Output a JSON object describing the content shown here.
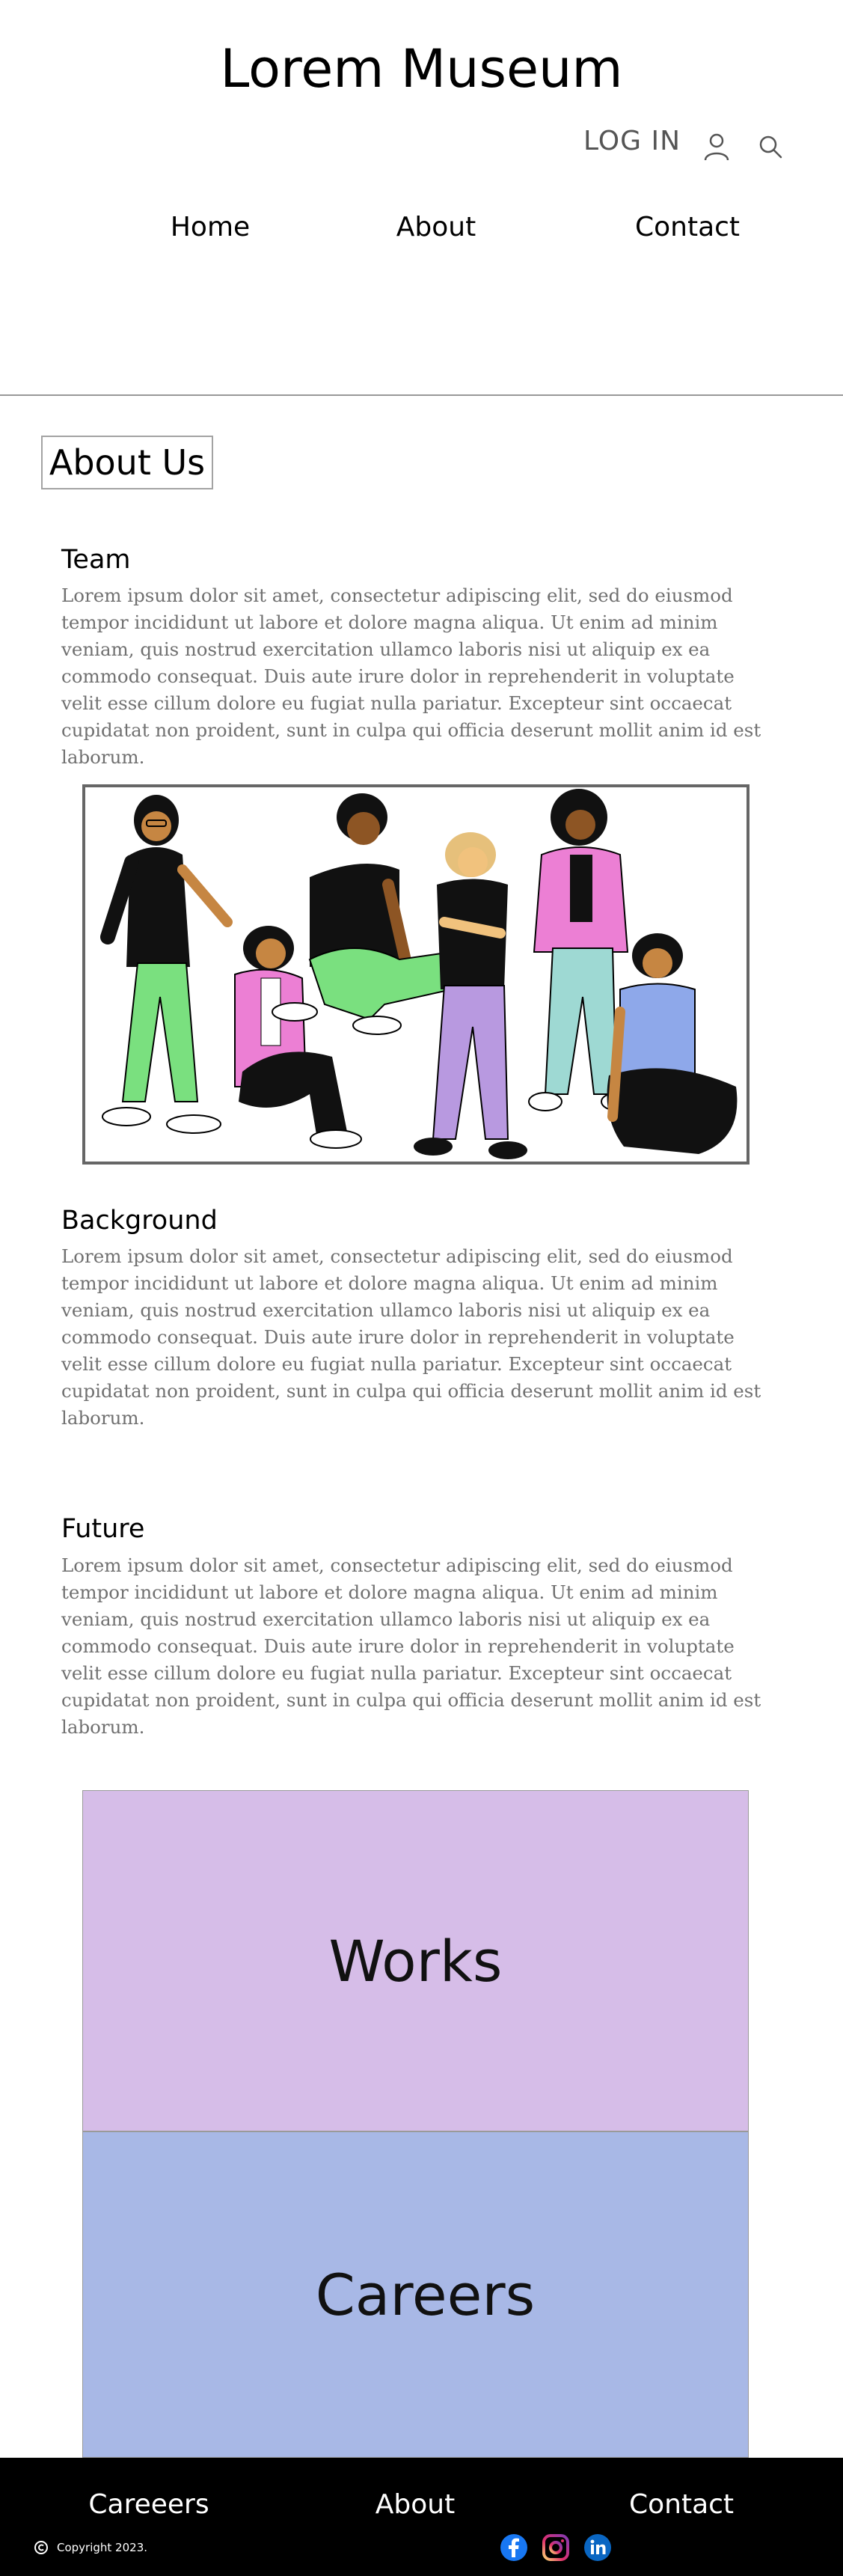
{
  "header": {
    "site_title": "Lorem Museum",
    "login_label": "LOG IN",
    "user_icon": "user-icon",
    "search_icon": "search-icon"
  },
  "nav": {
    "items": [
      {
        "label": "Home"
      },
      {
        "label": "About"
      },
      {
        "label": "Contact"
      }
    ]
  },
  "about": {
    "heading": "About Us",
    "sections": [
      {
        "title": "Team",
        "text": "Lorem ipsum dolor sit amet, consectetur adipiscing elit, sed do eiusmod tempor incididunt ut labore et dolore magna aliqua. Ut enim ad minim veniam, quis nostrud exercitation ullamco laboris nisi ut aliquip ex ea commodo consequat. Duis aute irure dolor in reprehenderit in voluptate velit esse cillum dolore eu fugiat nulla pariatur. Excepteur sint occaecat cupidatat non proident, sunt in culpa qui officia deserunt mollit anim id est laborum."
      },
      {
        "title": "Background",
        "text": "Lorem ipsum dolor sit amet, consectetur adipiscing elit, sed do eiusmod tempor incididunt ut labore et dolore magna aliqua. Ut enim ad minim veniam, quis nostrud exercitation ullamco laboris nisi ut aliquip ex ea commodo consequat. Duis aute irure dolor in reprehenderit in voluptate velit esse cillum dolore eu fugiat nulla pariatur. Excepteur sint occaecat cupidatat non proident, sunt in culpa qui officia deserunt mollit anim id est laborum."
      },
      {
        "title": "Future",
        "text": "Lorem ipsum dolor sit amet, consectetur adipiscing elit, sed do eiusmod tempor incididunt ut labore et dolore magna aliqua. Ut enim ad minim veniam, quis nostrud exercitation ullamco laboris nisi ut aliquip ex ea commodo consequat. Duis aute irure dolor in reprehenderit in voluptate velit esse cillum dolore eu fugiat nulla pariatur. Excepteur sint occaecat cupidatat non proident, sunt in culpa qui officia deserunt mollit anim id est laborum."
      }
    ]
  },
  "panels": {
    "works_label": "Works",
    "works_color": "#d6bde8",
    "careers_label": "Careers",
    "careers_color": "#a8b8e6"
  },
  "footer": {
    "links": [
      {
        "label": "Careeers"
      },
      {
        "label": "About"
      },
      {
        "label": "Contact"
      }
    ],
    "copyright": "Copyright 2023.",
    "social": [
      {
        "icon": "facebook-icon",
        "color": "#1877f2"
      },
      {
        "icon": "instagram-icon",
        "color": "#e1306c"
      },
      {
        "icon": "linkedin-icon",
        "color": "#0a66c2"
      }
    ]
  }
}
